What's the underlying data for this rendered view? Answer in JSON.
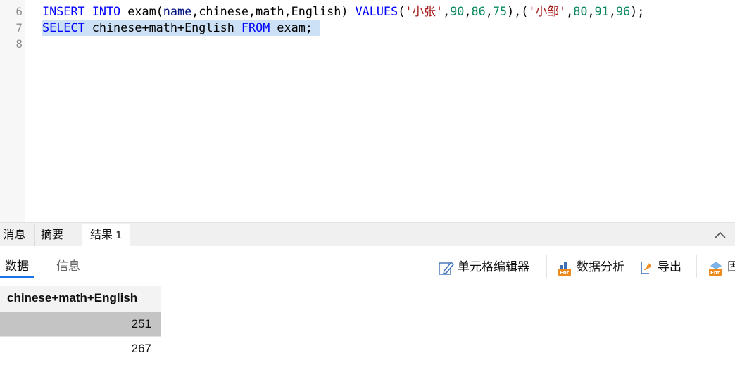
{
  "editor": {
    "lines": [
      {
        "n": "6",
        "tokens": [
          {
            "t": "INSERT",
            "c": "kw"
          },
          {
            "t": " ",
            "c": ""
          },
          {
            "t": "INTO",
            "c": "kw"
          },
          {
            "t": " exam(",
            "c": ""
          },
          {
            "t": "name",
            "c": "id"
          },
          {
            "t": ",chinese,math,English) ",
            "c": ""
          },
          {
            "t": "VALUES",
            "c": "kw"
          },
          {
            "t": "(",
            "c": ""
          },
          {
            "t": "'小张'",
            "c": "str"
          },
          {
            "t": ",",
            "c": ""
          },
          {
            "t": "90",
            "c": "num"
          },
          {
            "t": ",",
            "c": ""
          },
          {
            "t": "86",
            "c": "num"
          },
          {
            "t": ",",
            "c": ""
          },
          {
            "t": "75",
            "c": "num"
          },
          {
            "t": "),(",
            "c": ""
          },
          {
            "t": "'小邹'",
            "c": "str"
          },
          {
            "t": ",",
            "c": ""
          },
          {
            "t": "80",
            "c": "num"
          },
          {
            "t": ",",
            "c": ""
          },
          {
            "t": "91",
            "c": "num"
          },
          {
            "t": ",",
            "c": ""
          },
          {
            "t": "96",
            "c": "num"
          },
          {
            "t": ");",
            "c": ""
          }
        ]
      },
      {
        "n": "7",
        "selected": true,
        "tokens": [
          {
            "t": "SELECT",
            "c": "kw"
          },
          {
            "t": " chinese+math+English ",
            "c": ""
          },
          {
            "t": "FROM",
            "c": "kw"
          },
          {
            "t": " exam; ",
            "c": ""
          }
        ]
      },
      {
        "n": "8",
        "tokens": []
      }
    ]
  },
  "panel": {
    "tabs": [
      {
        "label": "消息",
        "active": false
      },
      {
        "label": "摘要",
        "active": false
      },
      {
        "label": "结果 1",
        "active": true
      }
    ],
    "subtabs": [
      {
        "label": "数据",
        "active": true
      },
      {
        "label": "信息",
        "active": false
      }
    ],
    "toolbar": {
      "cell_editor": "单元格编辑器",
      "data_analysis": "数据分析",
      "export": "导出",
      "partial": "固"
    }
  },
  "grid": {
    "columns": [
      "chinese+math+English"
    ],
    "rows": [
      [
        "251"
      ],
      [
        "267"
      ]
    ],
    "selected_row": 0
  },
  "colors": {
    "keyword": "#0000ff",
    "string": "#a31515",
    "number": "#09885a",
    "selection": "#cce1f5",
    "accent": "#1a73e8"
  }
}
